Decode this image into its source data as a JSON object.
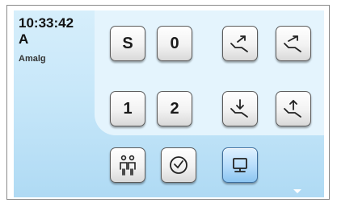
{
  "status": {
    "time": "10:33:42",
    "mode": "A",
    "program": "Amalg"
  },
  "buttons": {
    "s_label": "S",
    "zero_label": "0",
    "one_label": "1",
    "two_label": "2"
  },
  "icons": {
    "chair_back_up": "chair-backrest-up-icon",
    "chair_back_down": "chair-backrest-down-icon",
    "chair_down": "chair-down-icon",
    "chair_up": "chair-up-icon",
    "users": "users-icon",
    "timer": "clock-icon",
    "monitor": "monitor-icon"
  },
  "colors": {
    "background": "#c7e7f9",
    "panel": "#e4f4fd",
    "selected_button": "#b5dcfb"
  }
}
